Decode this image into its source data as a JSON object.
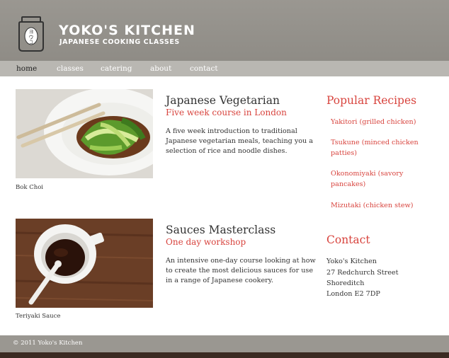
{
  "header": {
    "title": "YOKO'S KITCHEN",
    "subtitle": "JAPANESE COOKING CLASSES",
    "logo_icon": "kitchen-jar-logo-icon"
  },
  "nav": {
    "items": [
      "home",
      "classes",
      "catering",
      "about",
      "contact"
    ],
    "active": "home"
  },
  "courses": [
    {
      "caption": "Bok Choi",
      "title": "Japanese Vegetarian",
      "subtitle": "Five week course in London",
      "description": "A five week introduction to traditional Japanese vegetarian meals, teaching you a selection of rice and noodle dishes."
    },
    {
      "caption": "Teriyaki Sauce",
      "title": "Sauces Masterclass",
      "subtitle": "One day workshop",
      "description": "An intensive one-day course looking at how to create the most delicious sauces for use in a range of Japanese cookery."
    }
  ],
  "sidebar": {
    "recipes_heading": "Popular Recipes",
    "recipes": [
      "Yakitori (grilled chicken)",
      "Tsukune (minced chicken patties)",
      "Okonomiyaki (savory pancakes)",
      "Mizutaki (chicken stew)"
    ],
    "contact_heading": "Contact",
    "contact_lines": [
      "Yoko's Kitchen",
      "27 Redchurch Street",
      "Shoreditch",
      "London E2 7DP"
    ]
  },
  "footer": {
    "text": "© 2011 Yoko's Kitchen"
  },
  "colors": {
    "accent": "#d8443e",
    "header_bg": "#9a9791",
    "nav_bg": "#b9b7b2"
  }
}
